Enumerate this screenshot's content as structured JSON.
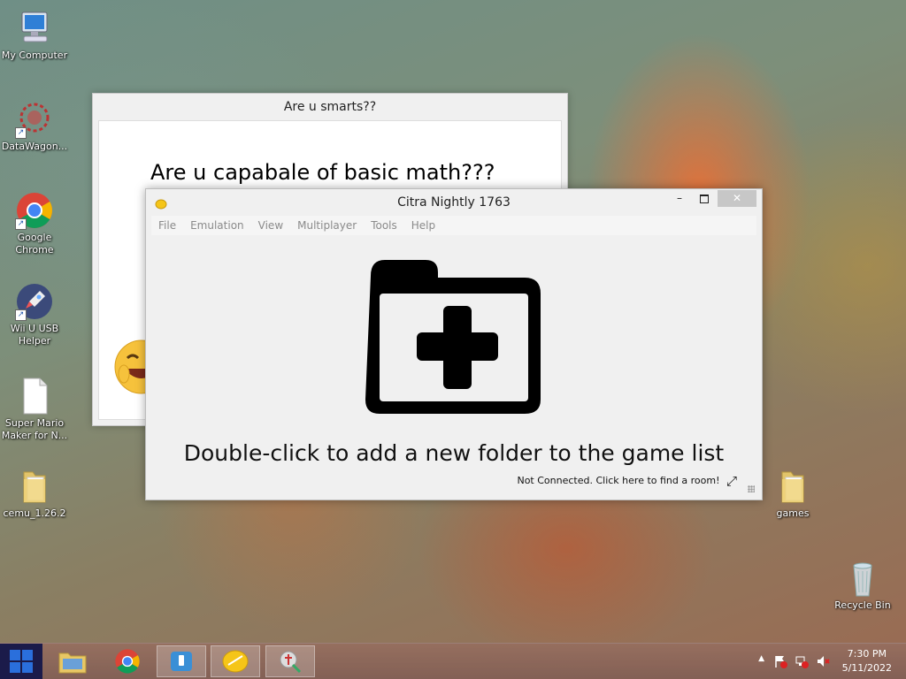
{
  "desktop": {
    "icons": [
      {
        "label": "My Computer"
      },
      {
        "label": "DataWagon..."
      },
      {
        "label": "Google Chrome"
      },
      {
        "label": "Wii U USB Helper"
      },
      {
        "label": "Super Mario Maker for N..."
      },
      {
        "label": "cemu_1.26.2"
      },
      {
        "label": "games"
      },
      {
        "label": "Recycle Bin"
      }
    ]
  },
  "back_window": {
    "title": "Are u smarts??",
    "question": "Are u capabale of basic math???"
  },
  "citra": {
    "title": "Citra Nightly 1763",
    "menu": [
      "File",
      "Emulation",
      "View",
      "Multiplayer",
      "Tools",
      "Help"
    ],
    "empty_message": "Double-click to add a new folder to the game list",
    "status": "Not Connected. Click here to find a room!",
    "minimize": "–",
    "close": "✕"
  },
  "taskbar": {
    "clock_time": "7:30 PM",
    "clock_date": "5/11/2022",
    "tray_arrow": "▲"
  },
  "colors": {
    "accent_close": "#c7c7c7",
    "taskbar": "#8a6455"
  }
}
